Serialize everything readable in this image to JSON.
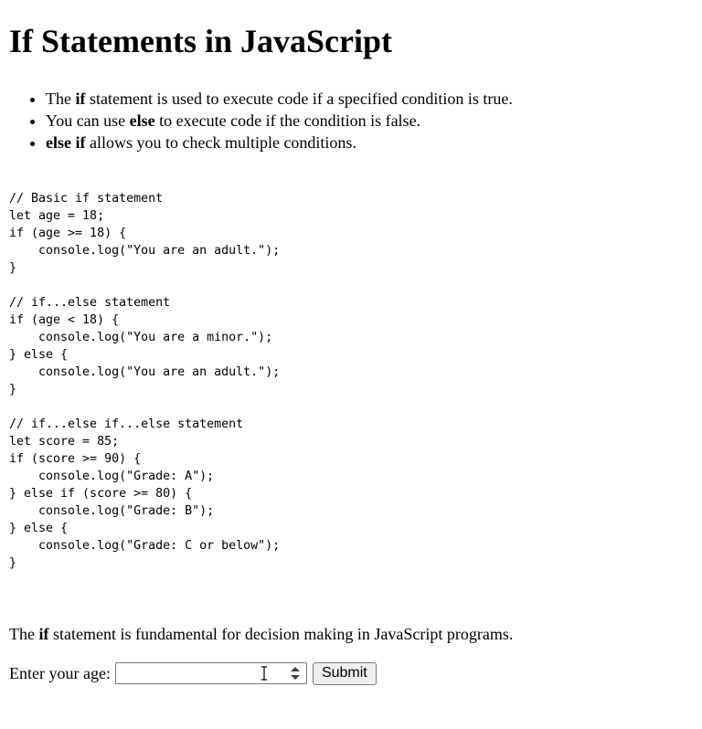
{
  "page": {
    "title": "If Statements in JavaScript"
  },
  "bullets": [
    {
      "before": "The ",
      "bold": "if",
      "after": " statement is used to execute code if a specified condition is true."
    },
    {
      "before": "You can use ",
      "bold": "else",
      "after": " to execute code if the condition is false."
    },
    {
      "before": "",
      "bold": "else if",
      "after": " allows you to check multiple conditions."
    }
  ],
  "code_block": "// Basic if statement\nlet age = 18;\nif (age >= 18) {\n    console.log(\"You are an adult.\");\n}\n\n// if...else statement\nif (age < 18) {\n    console.log(\"You are a minor.\");\n} else {\n    console.log(\"You are an adult.\");\n}\n\n// if...else if...else statement\nlet score = 85;\nif (score >= 90) {\n    console.log(\"Grade: A\");\n} else if (score >= 80) {\n    console.log(\"Grade: B\");\n} else {\n    console.log(\"Grade: C or below\");\n}",
  "summary": {
    "before": "The ",
    "bold": "if",
    "after": " statement is fundamental for decision making in JavaScript programs."
  },
  "form": {
    "label": "Enter your age:",
    "input_value": "",
    "submit_label": "Submit",
    "spinner_icon": "spinner-arrows-icon",
    "cursor_icon": "text-cursor-icon"
  }
}
